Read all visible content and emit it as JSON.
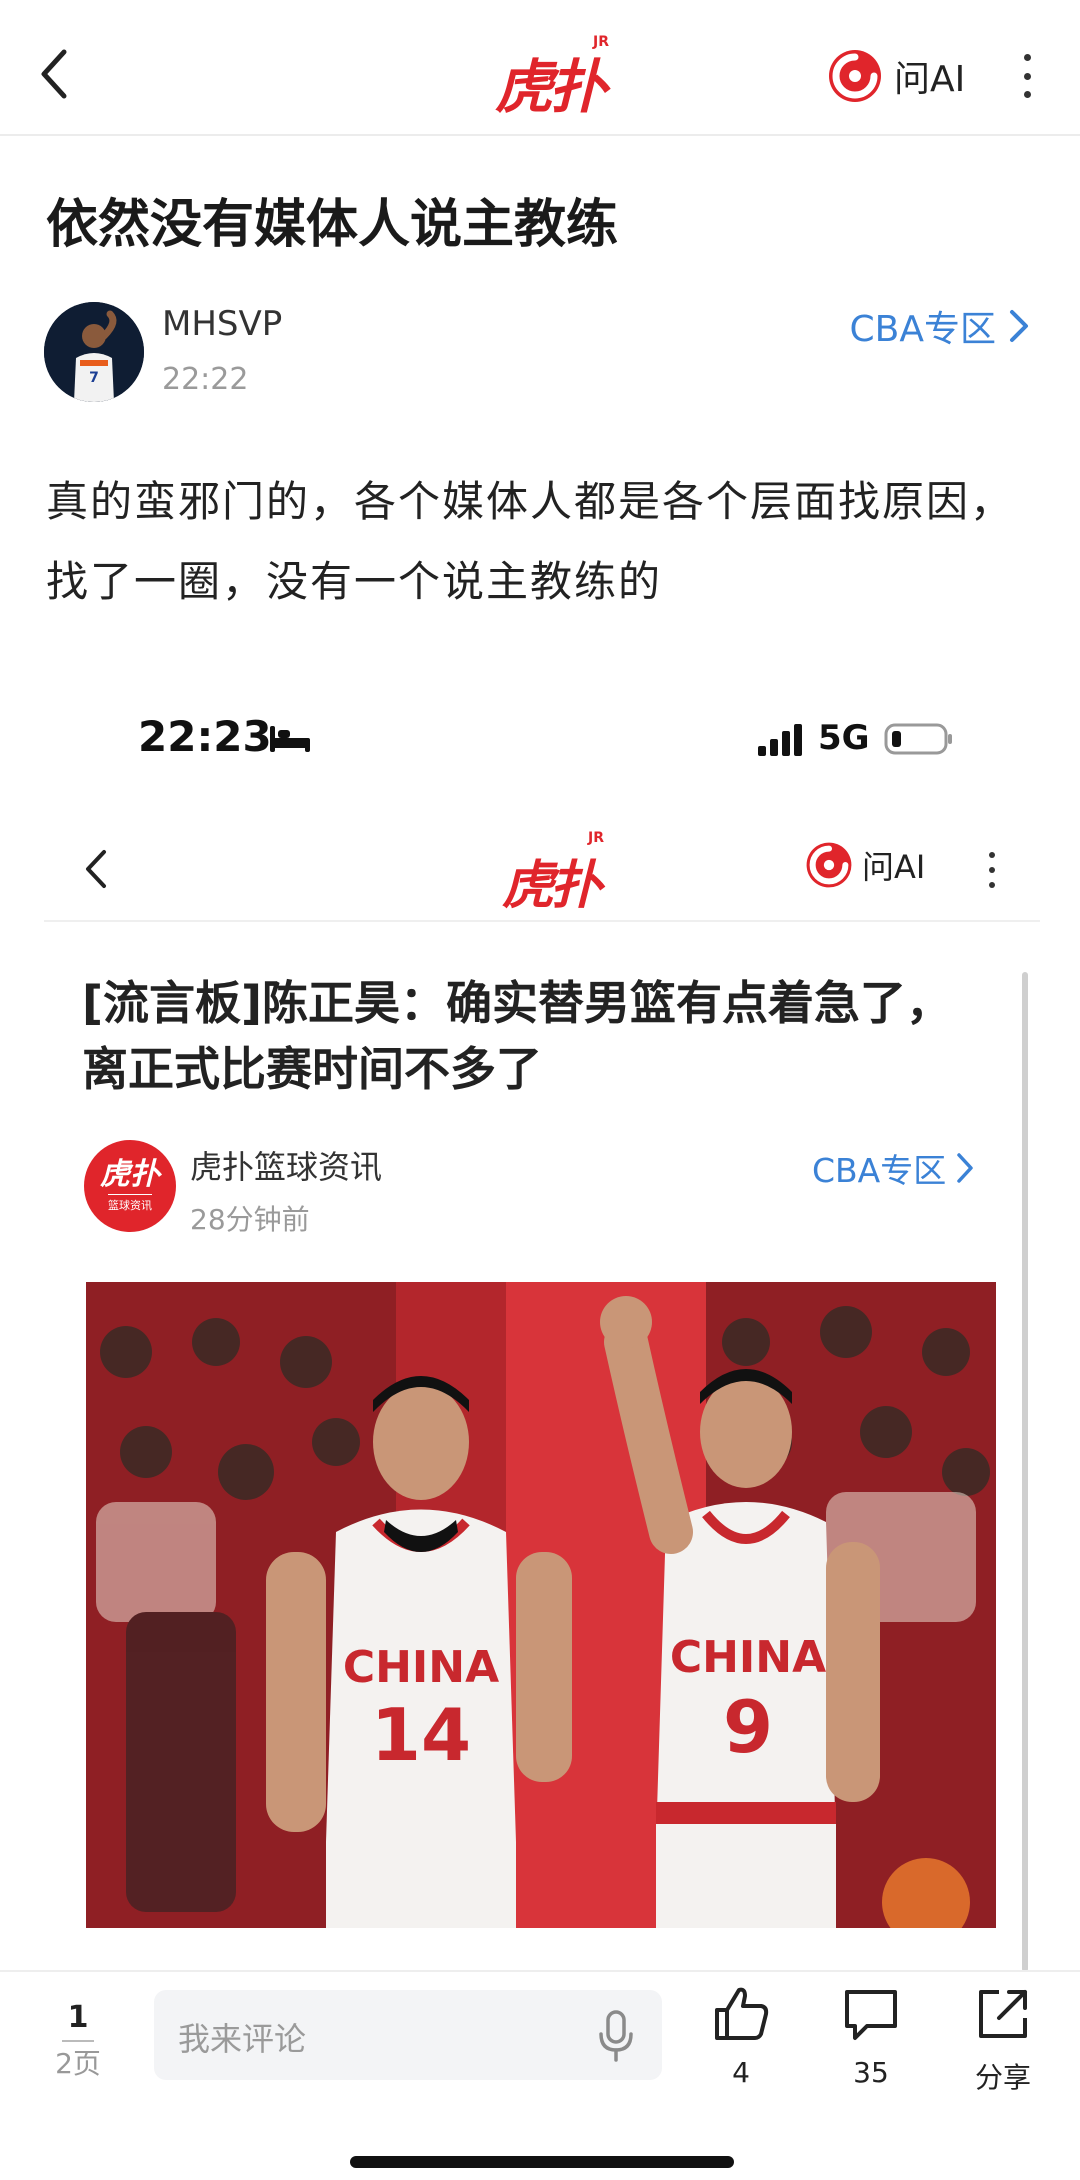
{
  "header": {
    "logo_text": "虎扑",
    "logo_badge": "JR",
    "ask_ai_label": "问AI"
  },
  "post": {
    "title": "依然没有媒体人说主教练",
    "author": "MHSVP",
    "time": "22:22",
    "zone_label": "CBA专区",
    "body": "真的蛮邪门的，各个媒体人都是各个层面找原因，找了一圈，没有一个说主教练的"
  },
  "embedded_screenshot": {
    "status_time": "22:23",
    "network": "5G",
    "header": {
      "logo_text": "虎扑",
      "logo_badge": "JR",
      "ask_ai_label": "问AI"
    },
    "article": {
      "title": "[流言板]陈正昊：确实替男篮有点着急了，离正式比赛时间不多了",
      "avatar_text": "虎扑",
      "avatar_subtext": "篮球资讯",
      "author": "虎扑篮球资讯",
      "time": "28分钟前",
      "zone_label": "CBA专区",
      "photo": {
        "player_left": {
          "team": "CHINA",
          "number": "14"
        },
        "player_right": {
          "team": "CHINA",
          "number": "9"
        }
      }
    }
  },
  "bottom_bar": {
    "page_current": "1",
    "page_total": "2页",
    "comment_placeholder": "我来评论",
    "like_count": "4",
    "comment_count": "35",
    "share_label": "分享"
  },
  "colors": {
    "brand_red": "#e0252b",
    "link_blue": "#3b82d6"
  }
}
